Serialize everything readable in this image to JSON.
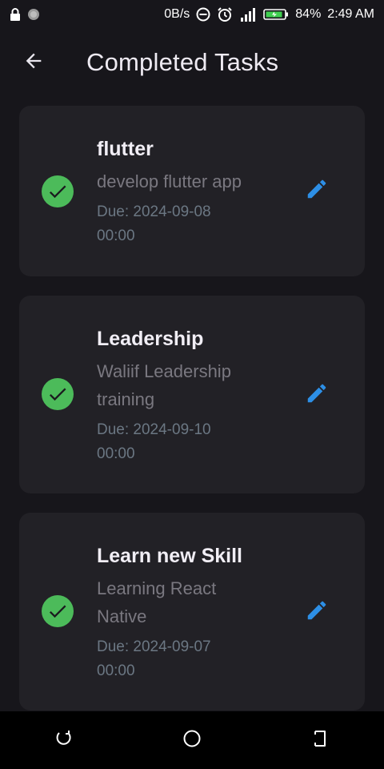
{
  "status_bar": {
    "speed": "0B/s",
    "battery": "84%",
    "time": "2:49 AM",
    "icons": [
      "lock-icon",
      "record-icon",
      "dnd-icon",
      "alarm-icon",
      "signal-icon",
      "battery-icon"
    ]
  },
  "app_bar": {
    "title": "Completed Tasks",
    "back_icon": "arrow-back-icon"
  },
  "tasks": [
    {
      "title": "flutter",
      "description": "develop flutter app",
      "due": "Due: 2024-09-08 00:00",
      "status_icon": "check-circle-icon",
      "action_icon": "edit-icon"
    },
    {
      "title": "Leadership",
      "description": "Waliif Leadership training",
      "due": "Due: 2024-09-10 00:00",
      "status_icon": "check-circle-icon",
      "action_icon": "edit-icon"
    },
    {
      "title": "Learn new Skill",
      "description": "Learning React Native",
      "due": "Due: 2024-09-07 00:00",
      "status_icon": "check-circle-icon",
      "action_icon": "edit-icon"
    }
  ],
  "colors": {
    "background": "#17161b",
    "card": "#222126",
    "check_green": "#4cbb5a",
    "edit_blue": "#2d8fe6"
  },
  "nav_bar": {
    "items": [
      "recents-icon",
      "home-icon",
      "back-icon"
    ]
  }
}
